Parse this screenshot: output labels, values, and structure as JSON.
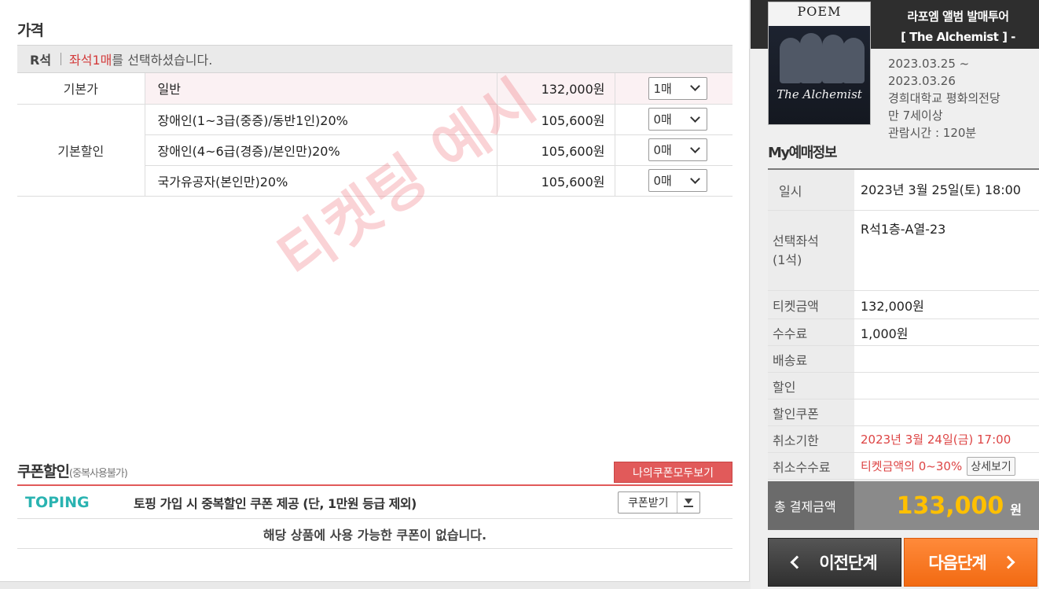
{
  "price_section": {
    "title": "가격",
    "seat_grade": "R석",
    "seat_msg_pre": "좌석 ",
    "seat_count": "1매",
    "seat_msg_post": "를 선택하셨습니다.",
    "rows": [
      {
        "category": "기본가",
        "name": "일반",
        "amount": "132,000원",
        "qty": "1매"
      },
      {
        "category": "기본할인",
        "name": "장애인(1~3급(중증)/동반1인)20%",
        "amount": "105,600원",
        "qty": "0매"
      },
      {
        "category": "",
        "name": "장애인(4~6급(경증)/본인만)20%",
        "amount": "105,600원",
        "qty": "0매"
      },
      {
        "category": "",
        "name": "국가유공자(본인만)20%",
        "amount": "105,600원",
        "qty": "0매"
      }
    ]
  },
  "watermark": "티켓팅 예시",
  "coupon": {
    "title": "쿠폰할인",
    "subtitle": "(중복사용불가)",
    "my_coupon_button": "나의쿠폰모두보기",
    "toping_logo": "TOPING",
    "toping_text": "토핑 가입 시 중복할인 쿠폰 제공 (단, 1만원 등급 제외)",
    "get_button": "쿠폰받기",
    "empty_msg": "해당 상품에 사용 가능한 쿠폰이 없습니다."
  },
  "event": {
    "poster_logo": "POEM",
    "poster_title": "The Alchemist",
    "title_line1": "라포엠 앨범 발매투어",
    "title_line2": "[ The Alchemist ] -",
    "date_from": "2023.03.25 ~",
    "date_to": "2023.03.26",
    "venue": "경희대학교 평화의전당",
    "age": "만 7세이상",
    "runtime": "관람시간 : 120분"
  },
  "my_booking": {
    "title": "My예매정보",
    "rows": [
      {
        "key": "일시",
        "value": "2023년 3월 25일(토) 18:00"
      },
      {
        "key": "선택좌석\n(1석)",
        "value": "R석1층-A열-23"
      },
      {
        "key": "티켓금액",
        "value": "132,000원"
      },
      {
        "key": "수수료",
        "value": "1,000원"
      },
      {
        "key": "배송료",
        "value": ""
      },
      {
        "key": "할인",
        "value": ""
      },
      {
        "key": "할인쿠폰",
        "value": ""
      },
      {
        "key": "취소기한",
        "value": "2023년 3월 24일(금) 17:00"
      },
      {
        "key": "취소수수료",
        "value": "티켓금액의 0~30%"
      }
    ],
    "detail_button": "상세보기",
    "total_label": "총 결제금액",
    "total_amount": "133,000",
    "total_unit": "원"
  },
  "nav": {
    "prev": "이전단계",
    "next": "다음단계"
  },
  "colors": {
    "accent_red": "#e15a5a",
    "next_orange": "#f26a12",
    "total_yellow": "#ffc000"
  }
}
